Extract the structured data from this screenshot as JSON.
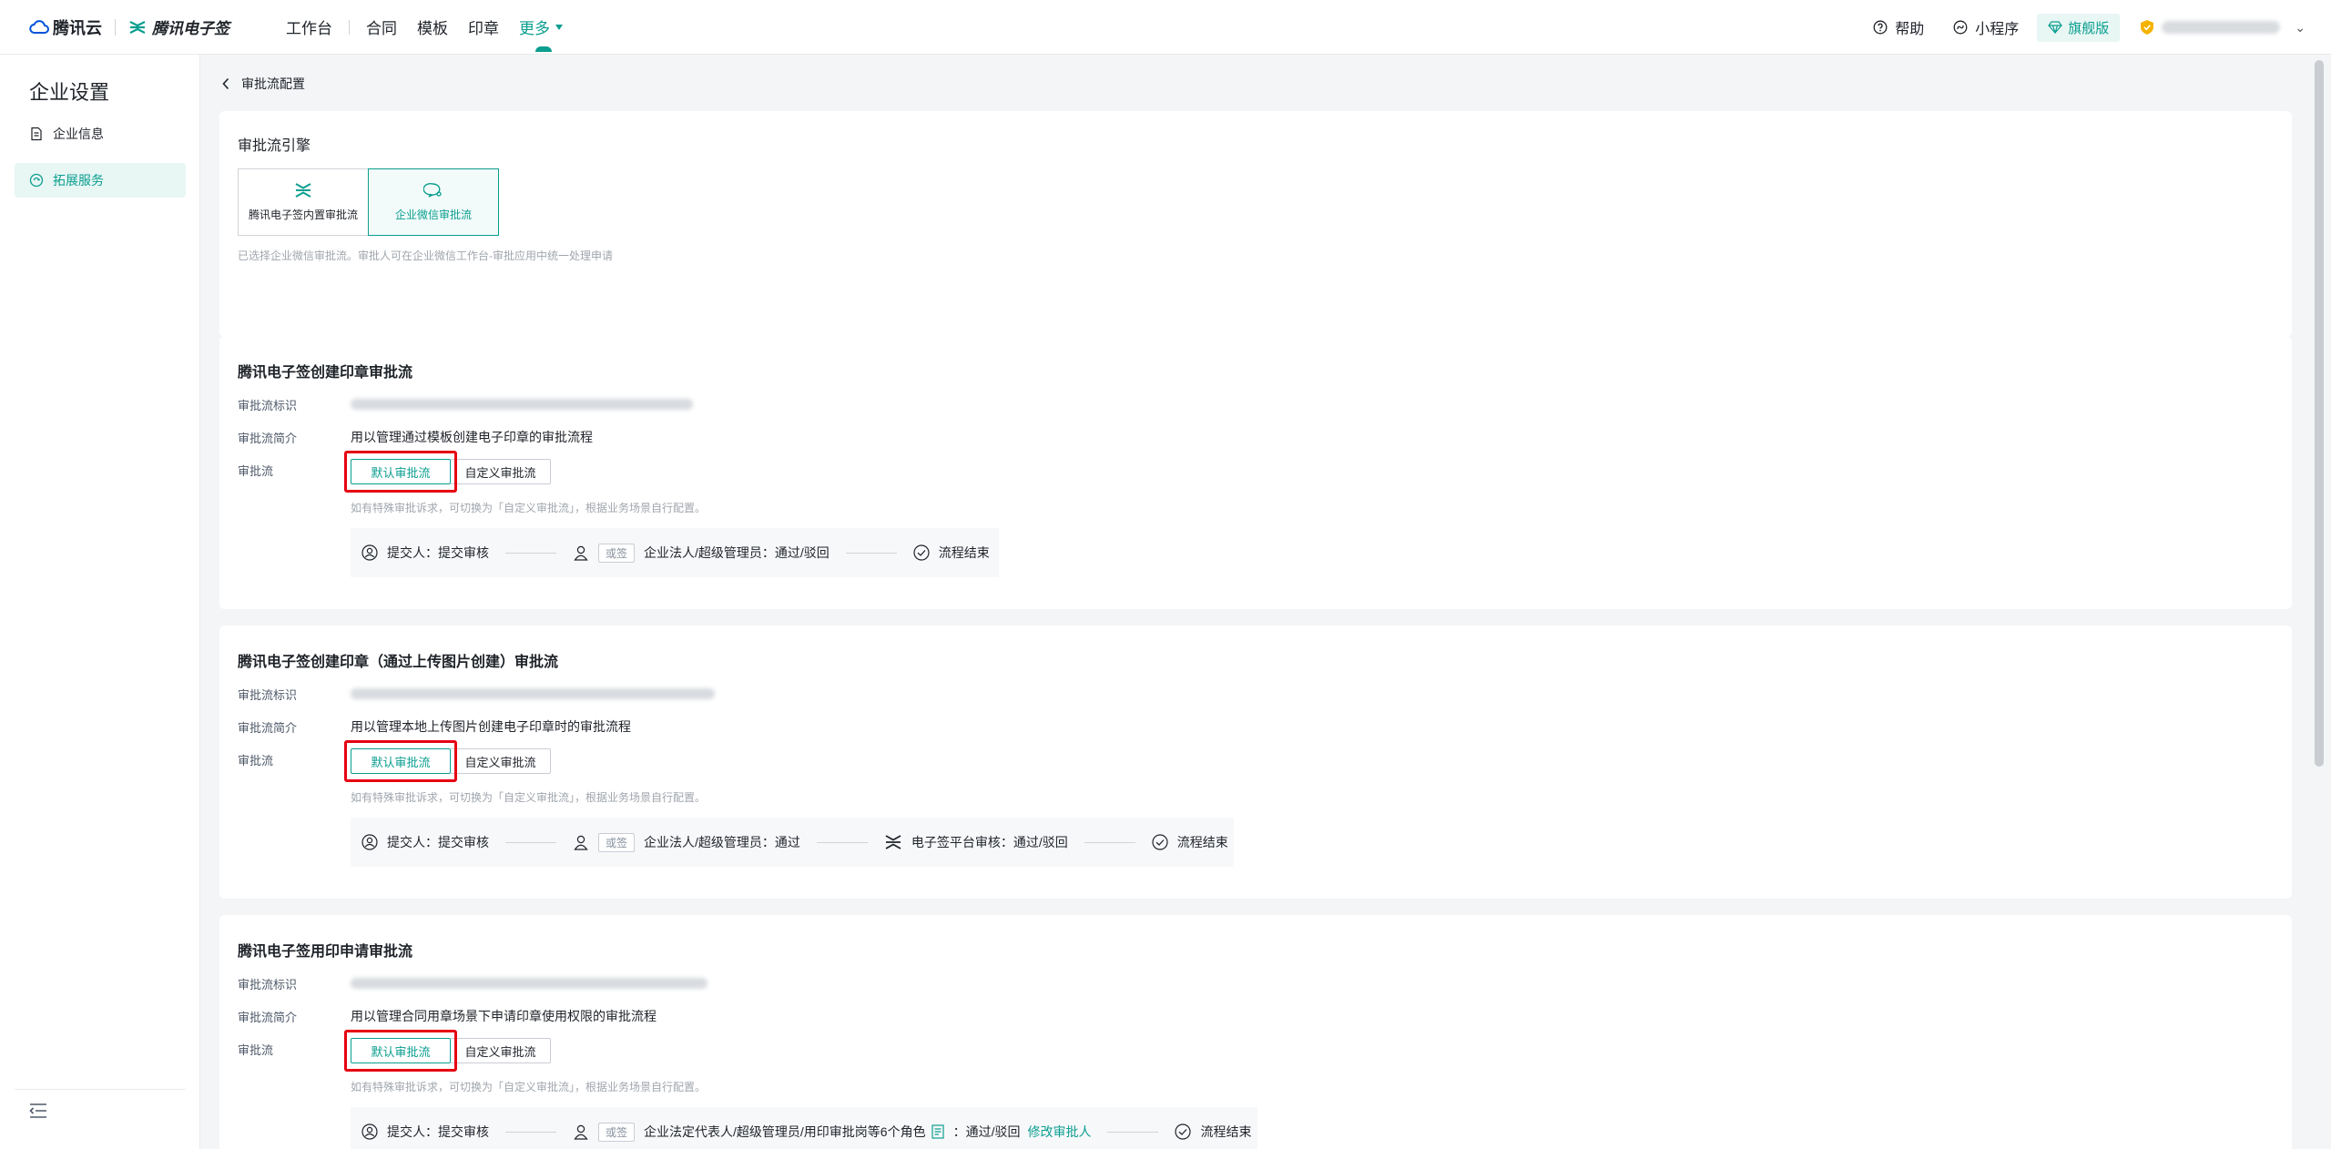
{
  "topbar": {
    "brand_cloud": "腾讯云",
    "brand_esign": "腾讯电子签",
    "workspace": "工作台",
    "nav": [
      "合同",
      "模板",
      "印章"
    ],
    "more": "更多",
    "help": "帮助",
    "miniprogram": "小程序",
    "edition": "旗舰版"
  },
  "sidebar": {
    "title": "企业设置",
    "items": [
      "企业信息",
      "拓展服务"
    ]
  },
  "breadcrumb": "审批流配置",
  "engine": {
    "title": "审批流引擎",
    "options": [
      "腾讯电子签内置审批流",
      "企业微信审批流"
    ],
    "hint": "已选择企业微信审批流。审批人可在企业微信工作台-审批应用中统一处理申请"
  },
  "labels": {
    "flow_id": "审批流标识",
    "flow_desc": "审批流简介",
    "flow": "审批流",
    "default_flow": "默认审批流",
    "custom_flow": "自定义审批流",
    "custom_hint": "如有特殊审批诉求，可切换为「自定义审批流」，根据业务场景自行配置。"
  },
  "sections": [
    {
      "title": "腾讯电子签创建印章审批流",
      "desc": "用以管理通过模板创建电子印章的审批流程",
      "flow": {
        "submitter": "提交人：提交审核",
        "tag": "或签",
        "approver": "企业法人/超级管理员：通过/驳回",
        "end": "流程结束"
      }
    },
    {
      "title": "腾讯电子签创建印章（通过上传图片创建）审批流",
      "desc": "用以管理本地上传图片创建电子印章时的审批流程",
      "flow": {
        "submitter": "提交人：提交审核",
        "tag": "或签",
        "approver": "企业法人/超级管理员：通过",
        "platform": "电子签平台审核：通过/驳回",
        "end": "流程结束"
      }
    },
    {
      "title": "腾讯电子签用印申请审批流",
      "desc": "用以管理合同用章场景下申请印章使用权限的审批流程",
      "flow": {
        "submitter": "提交人：提交审核",
        "tag": "或签",
        "approver": "企业法定代表人/超级管理员/用印审批岗等6个角色",
        "approver_suffix": "：通过/驳回",
        "modify_link": "修改审批人",
        "end": "流程结束"
      }
    }
  ],
  "colors": {
    "accent": "#0a9e8f",
    "highlight_box": "#e60012"
  }
}
